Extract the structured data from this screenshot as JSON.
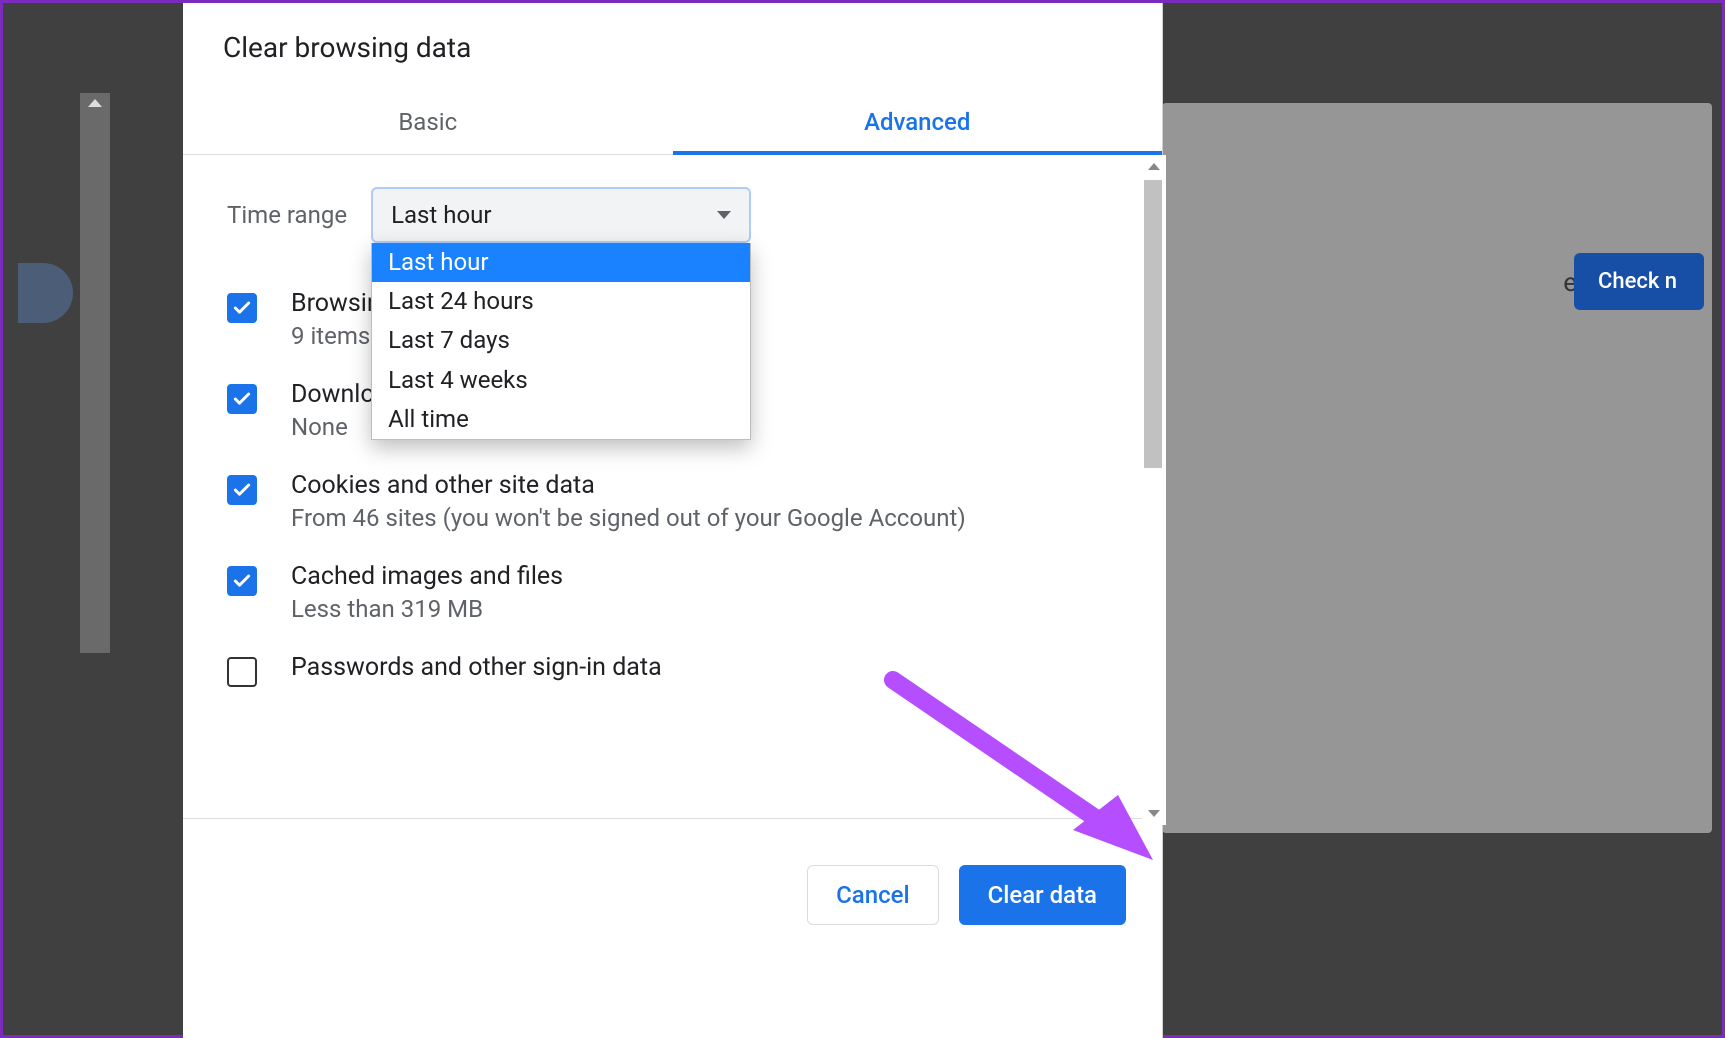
{
  "dialog": {
    "title": "Clear browsing data",
    "tabs": {
      "basic": "Basic",
      "advanced": "Advanced",
      "active": "advanced"
    },
    "time_range": {
      "label": "Time range",
      "selected": "Last hour",
      "options": [
        "Last hour",
        "Last 24 hours",
        "Last 7 days",
        "Last 4 weeks",
        "All time"
      ]
    },
    "items": [
      {
        "title": "Browsing history",
        "subtitle": "9 items",
        "checked": true
      },
      {
        "title": "Download history",
        "subtitle": "None",
        "checked": true
      },
      {
        "title": "Cookies and other site data",
        "subtitle": "From 46 sites (you won't be signed out of your Google Account)",
        "checked": true
      },
      {
        "title": "Cached images and files",
        "subtitle": "Less than 319 MB",
        "checked": true
      },
      {
        "title": "Passwords and other sign-in data",
        "subtitle": "",
        "checked": false
      }
    ],
    "buttons": {
      "cancel": "Cancel",
      "confirm": "Clear data"
    }
  },
  "background": {
    "check_button": "Check n",
    "text_frag": "e"
  }
}
